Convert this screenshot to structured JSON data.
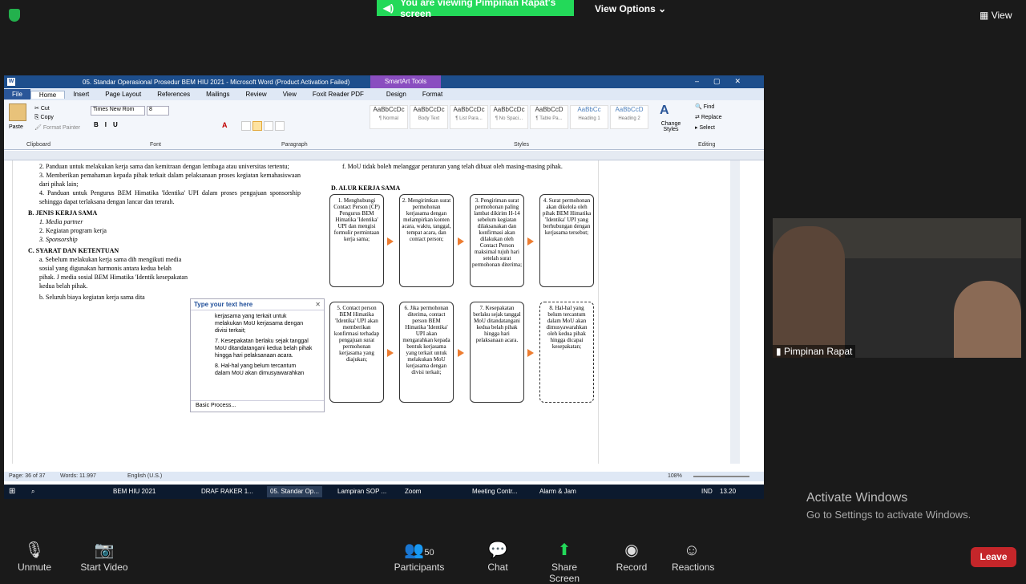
{
  "zoom": {
    "share_banner": "You are viewing Pimpinan Rapat's screen",
    "view_options": "View Options",
    "view": "View",
    "participant_name": "Pimpinan Rapat",
    "activate_title": "Activate Windows",
    "activate_sub": "Go to Settings to activate Windows.",
    "toolbar": {
      "unmute": "Unmute",
      "start_video": "Start Video",
      "participants": "Participants",
      "participants_count": "50",
      "chat": "Chat",
      "share_screen": "Share Screen",
      "record": "Record",
      "reactions": "Reactions",
      "leave": "Leave"
    }
  },
  "word": {
    "title": "05. Standar Operasional Prosedur BEM HIU 2021 - Microsoft Word (Product Activation Failed)",
    "smartart_tools": "SmartArt Tools",
    "tabs": [
      "File",
      "Home",
      "Insert",
      "Page Layout",
      "References",
      "Mailings",
      "Review",
      "View",
      "Foxit Reader PDF",
      "Design",
      "Format"
    ],
    "clipboard": {
      "paste": "Paste",
      "cut": "Cut",
      "copy": "Copy",
      "format_painter": "Format Painter",
      "label": "Clipboard"
    },
    "font": {
      "name": "Times New Rom",
      "size": "8",
      "label": "Font"
    },
    "paragraph_label": "Paragraph",
    "styles": [
      {
        "sample": "AaBbCcDc",
        "name": "¶ Normal"
      },
      {
        "sample": "AaBbCcDc",
        "name": "Body Text"
      },
      {
        "sample": "AaBbCcDc",
        "name": "¶ List Para..."
      },
      {
        "sample": "AaBbCcDc",
        "name": "¶ No Spaci..."
      },
      {
        "sample": "AaBbCcD",
        "name": "¶ Table Pa..."
      },
      {
        "sample": "AaBbCc",
        "name": "Heading 1"
      },
      {
        "sample": "AaBbCcD",
        "name": "Heading 2"
      }
    ],
    "styles_label": "Styles",
    "change_styles": "Change Styles",
    "editing": {
      "find": "Find",
      "replace": "Replace",
      "select": "Select",
      "label": "Editing"
    },
    "doc_left": [
      "2.   Panduan untuk melakukan kerja sama dan kemitraan dengan lembaga atau universitas tertentu;",
      "3.   Memberikan pemahaman kepada pihak terkait dalam pelaksanaan proses kegiatan kemahasiswaan dari pihak lain;",
      "4.   Panduan untuk Pengurus BEM Himatika 'Identika' UPI dalam proses pengajuan sponsorship sehingga dapat terlaksana dengan lancar dan terarah.",
      "B.   JENIS KERJA SAMA",
      "1.   Media partner",
      "2.   Kegiatan program kerja",
      "3.   Sponsorship",
      "C.   SYARAT DAN KETENTUAN",
      "a.   Sebelum melakukan kerja sama dih mengikuti media sosial yang digunakan harmonis antara kedua belah pihak. J media sosial BEM Himatika 'Identik kesepakatan kedua belah pihak.",
      "b.   Seluruh biaya kegiatan kerja sama dita"
    ],
    "doc_right_f": "f.   MoU tidak boleh melanggar peraturan yang telah dibuat oleh masing-masing pihak.",
    "doc_right_d": "D.   ALUR KERJA SAMA",
    "smartart_row1": [
      "1. Menghubungi Contact Person (CP) Pengurus BEM Himatika 'Identika' UPI dan mengisi formulir permintaan kerja sama;",
      "2. Mengirimkan surat permohonan kerjasama dengan melampirkan konten acara, waktu, tanggal, tempat acara, dan contact person;",
      "3. Pengiriman surat permohonan paling lambat dikirim H-14 sebelum kegiatan dilaksanakan dan konfirmasi akan dilakukan oleh Contact Person maksimal tujuh hari setelah surat permohonan diterima;",
      "4. Surat permohonan akan dikelola oleh pihak BEM Himatika 'Identika' UPI yang berhubungan dengan kerjasama tersebut;"
    ],
    "smartart_row2": [
      "5. Contact person BEM Himatika 'Identika' UPI akan memberikan konfirmasi terhadap pengajuan surat permohonan kerjasama yang diajukan;",
      "6. Jika permohonan diterima, contact person BEM Himatika 'Identika' UPI akan mengarahkan kepada bentuk kerjasama yang terkait untuk melakukan MoU kerjasama dengan divisi terkait;",
      "7. Kesepakatan berlaku sejak tanggal MoU ditandatangani kedua belah pihak hingga hari pelaksanaan acara.",
      "8. Hal-hal yang belum tercantum dalam MoU akan dimusyawarahkan oleh kedua pihak hingga dicapai kesepakatan;"
    ],
    "textpane": {
      "title": "Type your text here",
      "lines": [
        "kerjasama yang terkait untuk melakukan MoU kerjasama dengan divisi terkait;",
        "7. Kesepakatan berlaku sejak tanggal MoU ditandatangani kedua belah pihak hingga hari pelaksanaan acara.",
        "8. Hal-hal yang belum tercantum dalam MoU akan dimusyawarahkan oleh kedua"
      ],
      "footer": "Basic Process..."
    },
    "status": {
      "page": "Page: 36 of 37",
      "words": "Words: 11.997",
      "lang": "English (U.S.)",
      "zoom": "108%"
    },
    "taskbar": [
      "BEM HIU 2021",
      "DRAF RAKER 1...",
      "05. Standar Op...",
      "Lampiran SOP ...",
      "Zoom",
      "Meeting Contr...",
      "Alarm & Jam"
    ],
    "tray": {
      "lang": "IND",
      "time": "13.20"
    }
  }
}
